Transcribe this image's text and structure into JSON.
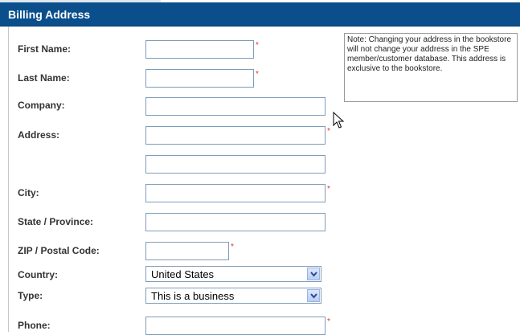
{
  "header": {
    "title": "Billing Address"
  },
  "note": {
    "text": "Note: Changing your address in the bookstore will not change your address in the SPE member/customer database. This address is exclusive to the bookstore."
  },
  "fields": {
    "first_name": {
      "label": "First Name:",
      "value": ""
    },
    "last_name": {
      "label": "Last Name:",
      "value": ""
    },
    "company": {
      "label": "Company:",
      "value": ""
    },
    "address": {
      "label": "Address:",
      "value": "",
      "value2": ""
    },
    "city": {
      "label": "City:",
      "value": ""
    },
    "state": {
      "label": "State / Province:",
      "value": ""
    },
    "zip": {
      "label": "ZIP / Postal Code:",
      "value": ""
    },
    "country": {
      "label": "Country:",
      "selected": "United States"
    },
    "type": {
      "label": "Type:",
      "selected": "This is a business"
    },
    "phone": {
      "label": "Phone:",
      "value": ""
    }
  },
  "required_marker": "*",
  "colors": {
    "header_bg": "#0a4f8c",
    "input_border": "#7f9db9",
    "required": "#e03030"
  },
  "icons": {
    "dropdown": "chevron-down-icon",
    "cursor": "mouse-pointer-icon"
  }
}
